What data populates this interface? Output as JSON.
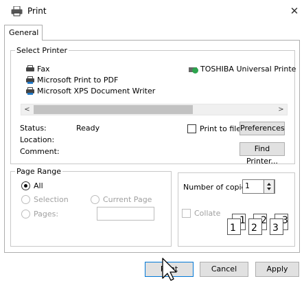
{
  "dialog": {
    "title": "Print",
    "close_glyph": "✕"
  },
  "tabs": [
    {
      "label": "General",
      "active": true
    }
  ],
  "select_printer": {
    "legend": "Select Printer",
    "printers": [
      {
        "name": "Fax",
        "icon": "printer-icon",
        "selected": false
      },
      {
        "name": "TOSHIBA Universal Printe",
        "icon": "default-printer-icon",
        "selected": false
      },
      {
        "name": "Microsoft Print to PDF",
        "icon": "printer-icon",
        "selected": false
      },
      {
        "name": "Microsoft XPS Document Writer",
        "icon": "printer-icon",
        "selected": false
      }
    ],
    "scroll_left": "<",
    "scroll_right": ">",
    "status_label": "Status:",
    "status_value": "Ready",
    "location_label": "Location:",
    "location_value": "",
    "comment_label": "Comment:",
    "comment_value": "",
    "print_to_file": {
      "label": "Print to file",
      "checked": false
    },
    "preferences_button": "Preferences",
    "find_printer_button": "Find Printer..."
  },
  "page_range": {
    "legend": "Page Range",
    "all": {
      "label": "All",
      "selected": true
    },
    "selection": {
      "label": "Selection",
      "enabled": false
    },
    "current_page": {
      "label": "Current Page",
      "enabled": false
    },
    "pages": {
      "label": "Pages:",
      "enabled": false,
      "value": ""
    }
  },
  "copies": {
    "label": "Number of copies:",
    "value": "1",
    "collate": {
      "label": "Collate",
      "checked": false,
      "enabled": false
    },
    "collate_pages": [
      "1",
      "1",
      "2",
      "2",
      "3",
      "3"
    ]
  },
  "buttons": {
    "print": "Print",
    "cancel": "Cancel",
    "apply": "Apply"
  },
  "colors": {
    "accent": "#0078d7",
    "scroll_thumb": "#c2c2c2",
    "disabled_text": "#a0a0a0"
  }
}
